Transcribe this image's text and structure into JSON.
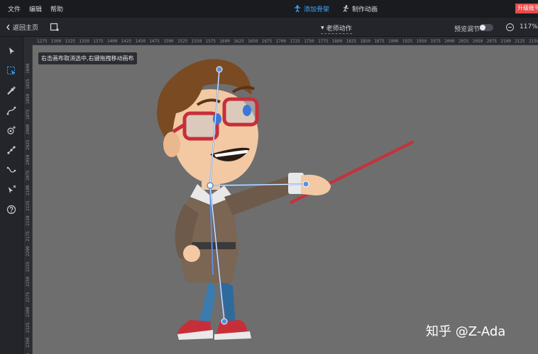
{
  "menu": {
    "items": [
      "文件",
      "编辑",
      "帮助"
    ]
  },
  "mode_tabs": [
    {
      "label": "添加骨架",
      "icon": "person-icon",
      "active": true
    },
    {
      "label": "制作动画",
      "icon": "runner-icon",
      "active": false
    }
  ],
  "upgrade": {
    "label": "升级账号"
  },
  "toolbar": {
    "back_label": "返回主页",
    "action_select": "老师动作",
    "preview_label": "预览调节",
    "zoom_level": "117%"
  },
  "tools": [
    {
      "name": "select-tool",
      "icon": "arrow-icon"
    },
    {
      "name": "bone-select-tool",
      "icon": "dashed-select-icon"
    },
    {
      "name": "add-bone-tool",
      "icon": "bone-add-icon"
    },
    {
      "name": "curve-tool",
      "icon": "curve-icon"
    },
    {
      "name": "pin-tool",
      "icon": "target-add-icon"
    },
    {
      "name": "bone-chain-tool",
      "icon": "bone-chain-icon"
    },
    {
      "name": "path-tool",
      "icon": "path-icon"
    },
    {
      "name": "pointer-remove-tool",
      "icon": "pointer-x-icon"
    },
    {
      "name": "help-tool",
      "icon": "help-icon"
    }
  ],
  "ruler_top": [
    "1275",
    "1300",
    "1325",
    "1350",
    "1375",
    "1400",
    "1425",
    "1450",
    "1475",
    "1500",
    "1525",
    "1550",
    "1575",
    "1600",
    "1625",
    "1650",
    "1675",
    "1700",
    "1725",
    "1750",
    "1775",
    "1800",
    "1825",
    "1850",
    "1875",
    "1900",
    "1925",
    "1950",
    "1975",
    "2000",
    "2025",
    "2050",
    "2075",
    "2100",
    "2125",
    "2150"
  ],
  "ruler_left": [
    "1600",
    "1825",
    "1850",
    "1875",
    "2000",
    "2025",
    "2050",
    "2075",
    "2100",
    "2125",
    "2150",
    "2175",
    "2200",
    "2225",
    "2250",
    "2275",
    "2300",
    "2325",
    "2350",
    "2375"
  ],
  "canvas": {
    "hint": "右击画布取消选中,右键拖拽移动画布",
    "background": "#6e6e6e"
  },
  "colors": {
    "accent": "#3ea6ff",
    "upgrade": "#e84a4a",
    "bone": "#5b8fe0",
    "pointer": "#c8303a"
  },
  "watermark": "知乎 @Z-Ada"
}
